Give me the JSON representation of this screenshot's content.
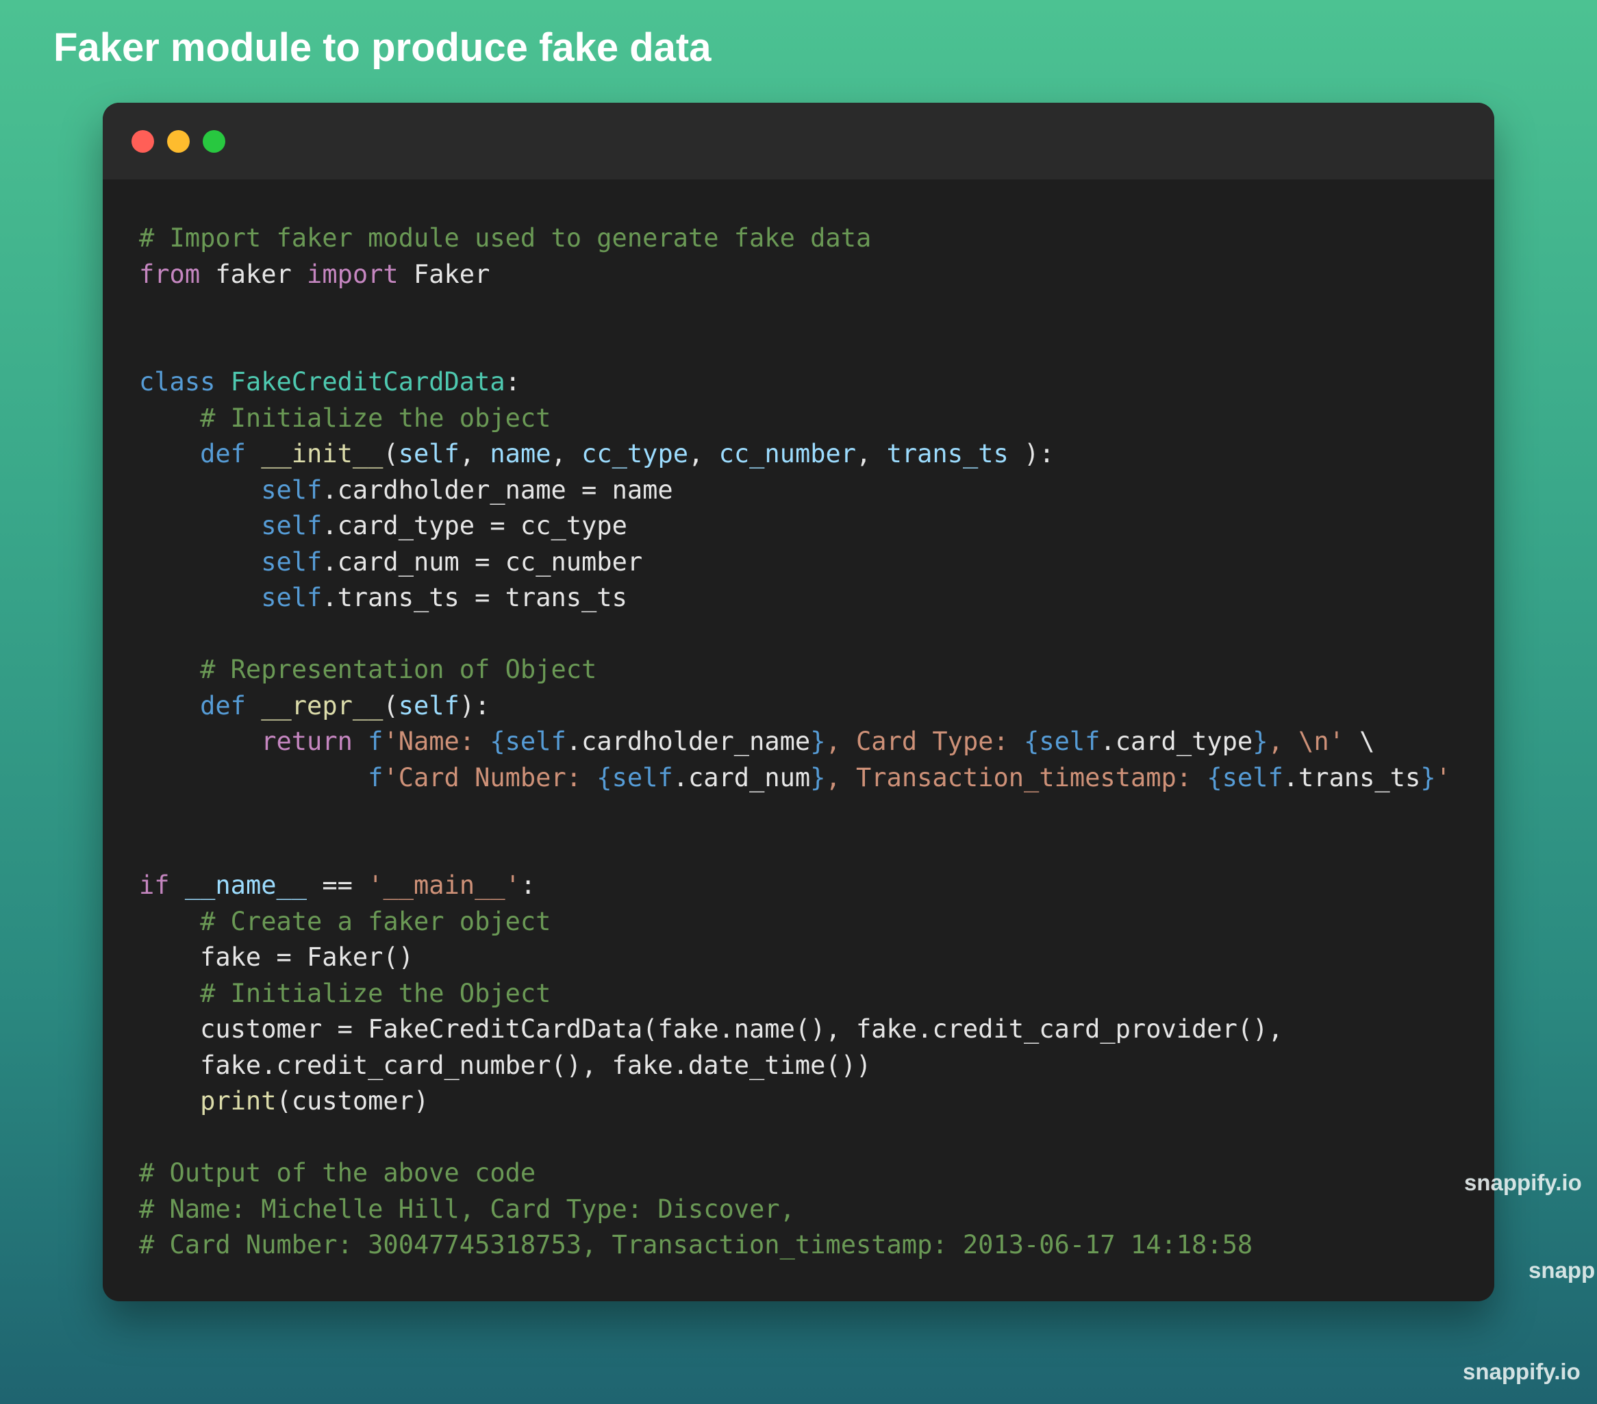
{
  "page": {
    "title": "Faker module to produce fake data"
  },
  "window": {
    "controls": [
      "close",
      "minimize",
      "maximize"
    ]
  },
  "code": {
    "language": "python",
    "lines": [
      [
        {
          "t": "comment",
          "v": "# Import faker module used to generate fake data"
        }
      ],
      [
        {
          "t": "keyword",
          "v": "from"
        },
        {
          "t": "plain",
          "v": " faker "
        },
        {
          "t": "keyword",
          "v": "import"
        },
        {
          "t": "plain",
          "v": " Faker"
        }
      ],
      [],
      [],
      [
        {
          "t": "storage",
          "v": "class"
        },
        {
          "t": "plain",
          "v": " "
        },
        {
          "t": "class",
          "v": "FakeCreditCardData"
        },
        {
          "t": "plain",
          "v": ":"
        }
      ],
      [
        {
          "t": "plain",
          "v": "    "
        },
        {
          "t": "comment",
          "v": "# Initialize the object"
        }
      ],
      [
        {
          "t": "plain",
          "v": "    "
        },
        {
          "t": "storage",
          "v": "def"
        },
        {
          "t": "plain",
          "v": " "
        },
        {
          "t": "func",
          "v": "__init__"
        },
        {
          "t": "plain",
          "v": "("
        },
        {
          "t": "param",
          "v": "self"
        },
        {
          "t": "plain",
          "v": ", "
        },
        {
          "t": "param",
          "v": "name"
        },
        {
          "t": "plain",
          "v": ", "
        },
        {
          "t": "param",
          "v": "cc_type"
        },
        {
          "t": "plain",
          "v": ", "
        },
        {
          "t": "param",
          "v": "cc_number"
        },
        {
          "t": "plain",
          "v": ", "
        },
        {
          "t": "param",
          "v": "trans_ts"
        },
        {
          "t": "plain",
          "v": " ):"
        }
      ],
      [
        {
          "t": "plain",
          "v": "        "
        },
        {
          "t": "self",
          "v": "self"
        },
        {
          "t": "plain",
          "v": ".cardholder_name = name"
        }
      ],
      [
        {
          "t": "plain",
          "v": "        "
        },
        {
          "t": "self",
          "v": "self"
        },
        {
          "t": "plain",
          "v": ".card_type = cc_type"
        }
      ],
      [
        {
          "t": "plain",
          "v": "        "
        },
        {
          "t": "self",
          "v": "self"
        },
        {
          "t": "plain",
          "v": ".card_num = cc_number"
        }
      ],
      [
        {
          "t": "plain",
          "v": "        "
        },
        {
          "t": "self",
          "v": "self"
        },
        {
          "t": "plain",
          "v": ".trans_ts = trans_ts"
        }
      ],
      [],
      [
        {
          "t": "plain",
          "v": "    "
        },
        {
          "t": "comment",
          "v": "# Representation of Object"
        }
      ],
      [
        {
          "t": "plain",
          "v": "    "
        },
        {
          "t": "storage",
          "v": "def"
        },
        {
          "t": "plain",
          "v": " "
        },
        {
          "t": "func",
          "v": "__repr__"
        },
        {
          "t": "plain",
          "v": "("
        },
        {
          "t": "param",
          "v": "self"
        },
        {
          "t": "plain",
          "v": "):"
        }
      ],
      [
        {
          "t": "plain",
          "v": "        "
        },
        {
          "t": "keyword",
          "v": "return"
        },
        {
          "t": "plain",
          "v": " "
        },
        {
          "t": "storage",
          "v": "f"
        },
        {
          "t": "string",
          "v": "'Name: "
        },
        {
          "t": "storage",
          "v": "{self"
        },
        {
          "t": "plain",
          "v": ".cardholder_name"
        },
        {
          "t": "storage",
          "v": "}"
        },
        {
          "t": "string",
          "v": ", Card Type: "
        },
        {
          "t": "storage",
          "v": "{self"
        },
        {
          "t": "plain",
          "v": ".card_type"
        },
        {
          "t": "storage",
          "v": "}"
        },
        {
          "t": "string",
          "v": ", \\n'"
        },
        {
          "t": "plain",
          "v": " \\"
        }
      ],
      [
        {
          "t": "plain",
          "v": "               "
        },
        {
          "t": "storage",
          "v": "f"
        },
        {
          "t": "string",
          "v": "'Card Number: "
        },
        {
          "t": "storage",
          "v": "{self"
        },
        {
          "t": "plain",
          "v": ".card_num"
        },
        {
          "t": "storage",
          "v": "}"
        },
        {
          "t": "string",
          "v": ", Transaction_timestamp: "
        },
        {
          "t": "storage",
          "v": "{self"
        },
        {
          "t": "plain",
          "v": ".trans_ts"
        },
        {
          "t": "storage",
          "v": "}"
        },
        {
          "t": "string",
          "v": "'"
        }
      ],
      [],
      [],
      [
        {
          "t": "keyword",
          "v": "if"
        },
        {
          "t": "plain",
          "v": " "
        },
        {
          "t": "param",
          "v": "__name__"
        },
        {
          "t": "plain",
          "v": " == "
        },
        {
          "t": "string",
          "v": "'__main__'"
        },
        {
          "t": "plain",
          "v": ":"
        }
      ],
      [
        {
          "t": "plain",
          "v": "    "
        },
        {
          "t": "comment",
          "v": "# Create a faker object"
        }
      ],
      [
        {
          "t": "plain",
          "v": "    fake = Faker()"
        }
      ],
      [
        {
          "t": "plain",
          "v": "    "
        },
        {
          "t": "comment",
          "v": "# Initialize the Object"
        }
      ],
      [
        {
          "t": "plain",
          "v": "    customer = FakeCreditCardData(fake.name(), fake.credit_card_provider(),"
        }
      ],
      [
        {
          "t": "plain",
          "v": "    fake.credit_card_number(), fake.date_time())"
        }
      ],
      [
        {
          "t": "plain",
          "v": "    "
        },
        {
          "t": "func",
          "v": "print"
        },
        {
          "t": "plain",
          "v": "(customer)"
        }
      ],
      [],
      [
        {
          "t": "comment",
          "v": "# Output of the above code"
        }
      ],
      [
        {
          "t": "comment",
          "v": "# Name: Michelle Hill, Card Type: Discover,"
        }
      ],
      [
        {
          "t": "comment",
          "v": "# Card Number: 30047745318753, Transaction_timestamp: 2013-06-17 14:18:58"
        }
      ]
    ]
  },
  "watermarks": [
    "snappify.io",
    "snapp",
    "snappify.io"
  ],
  "colors": {
    "comment": "#6a9955",
    "keyword": "#c586c0",
    "storage": "#569cd6",
    "class": "#4ec9b0",
    "func": "#dcdcaa",
    "param": "#9cdcfe",
    "string": "#ce9178",
    "plain": "#e6e6e6",
    "window_bg": "#1e1e1e",
    "titlebar_bg": "#2a2a2a"
  }
}
